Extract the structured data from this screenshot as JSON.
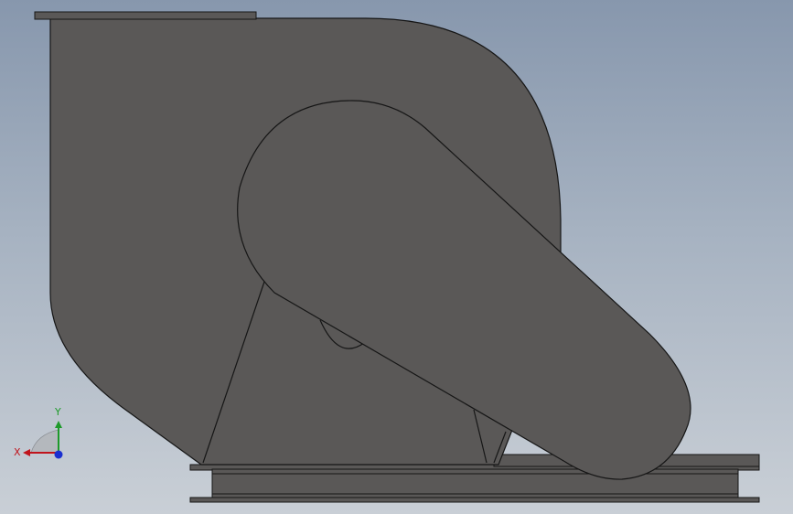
{
  "viewport": {
    "background_top": "#8797ad",
    "background_bottom": "#c9cfd6"
  },
  "model": {
    "body_color": "#5a5857",
    "edge_color": "#161616",
    "parts": [
      "fan-housing",
      "top-flange",
      "motor-duct",
      "support-frame",
      "base-channel",
      "drive-shaft-hub"
    ]
  },
  "triad": {
    "x_label": "X",
    "y_label": "Y",
    "x_color": "#c0141c",
    "y_color": "#1e9a2a",
    "z_color": "#1a2fd0"
  }
}
